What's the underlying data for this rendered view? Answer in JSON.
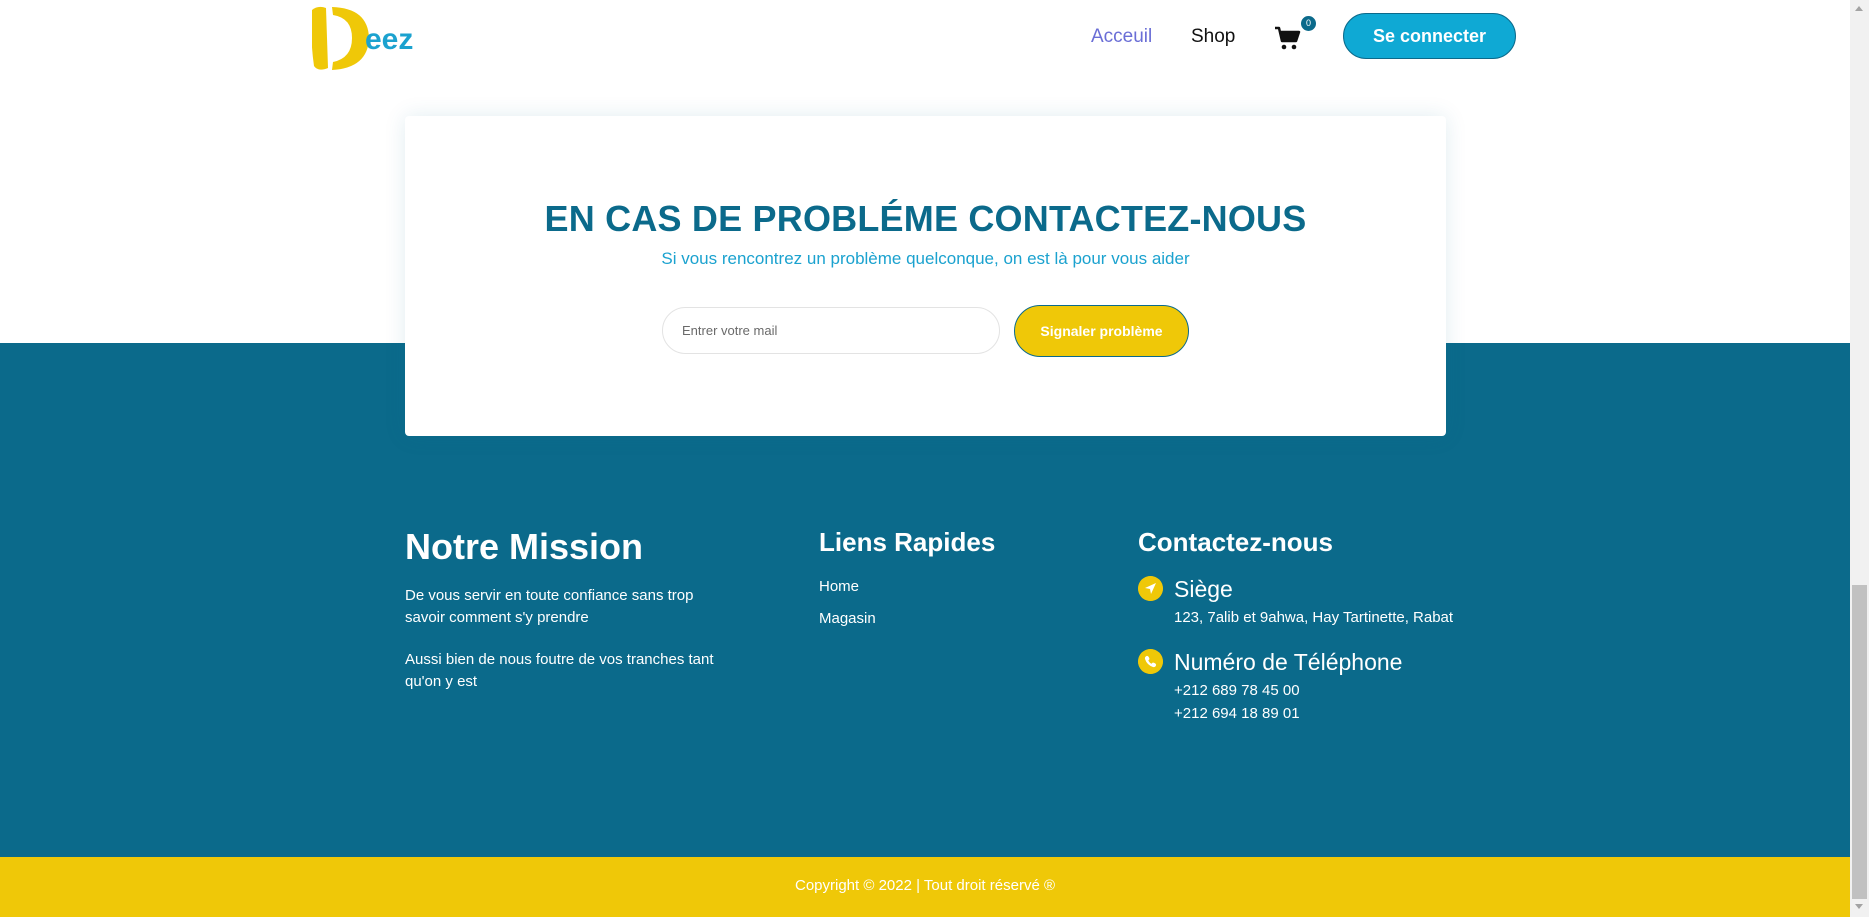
{
  "header": {
    "logo_text": "eez",
    "nav": {
      "home": "Acceuil",
      "shop": "Shop"
    },
    "cart": {
      "icon": "cart-icon",
      "count": "0"
    },
    "login_button": "Se connecter"
  },
  "contact_card": {
    "title": "EN CAS DE PROBLÉME CONTACTEZ-NOUS",
    "subtitle": "Si vous rencontrez un problème quelconque, on est là pour vous aider",
    "email_placeholder": "Entrer votre mail",
    "submit_label": "Signaler problème"
  },
  "footer": {
    "mission": {
      "title": "Notre Mission",
      "paragraphs": [
        "De vous servir en toute confiance sans trop savoir comment s'y prendre",
        "Aussi bien de nous foutre de vos tranches tant qu'on y est"
      ]
    },
    "links": {
      "title": "Liens Rapides",
      "items": [
        "Home",
        "Magasin"
      ]
    },
    "contact": {
      "title": "Contactez-nous",
      "address_label": "Siège",
      "address": "123, 7alib et 9ahwa, Hay Tartinette, Rabat",
      "phone_label": "Numéro de Téléphone",
      "phones": [
        "+212 689 78 45 00",
        "+212 694 18 89 01"
      ]
    }
  },
  "copyright": "Copyright © 2022 | Tout droit réservé ®",
  "colors": {
    "primary": "#0b6a8b",
    "accent": "#efc808",
    "button": "#0fa9d4",
    "nav_active": "#6a6ed6"
  }
}
